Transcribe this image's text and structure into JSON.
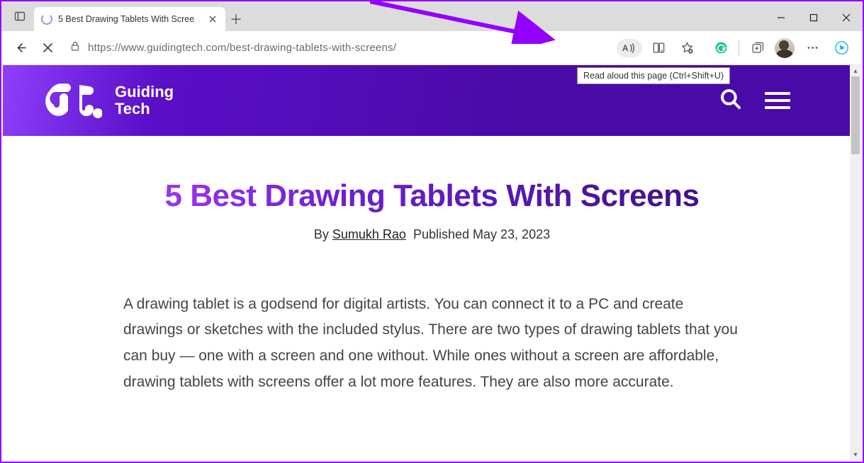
{
  "window": {
    "tab_title": "5 Best Drawing Tablets With Scree"
  },
  "toolbar": {
    "url": "https://www.guidingtech.com/best-drawing-tablets-with-screens/",
    "tooltip": "Read aloud this page (Ctrl+Shift+U)"
  },
  "site": {
    "name_line1": "Guiding",
    "name_line2": "Tech"
  },
  "article": {
    "title": "5 Best Drawing Tablets With Screens",
    "by_prefix": "By ",
    "author": "Sumukh Rao",
    "published_prefix": "Published ",
    "published": "May 23, 2023",
    "paragraph": "A drawing tablet is a godsend for digital artists. You can connect it to a PC and create drawings or sketches with the included stylus. There are two types of drawing tablets that you can buy — one with a screen and one without. While ones without a screen are affordable, drawing tablets with screens offer a lot more features. They are also more accurate."
  }
}
